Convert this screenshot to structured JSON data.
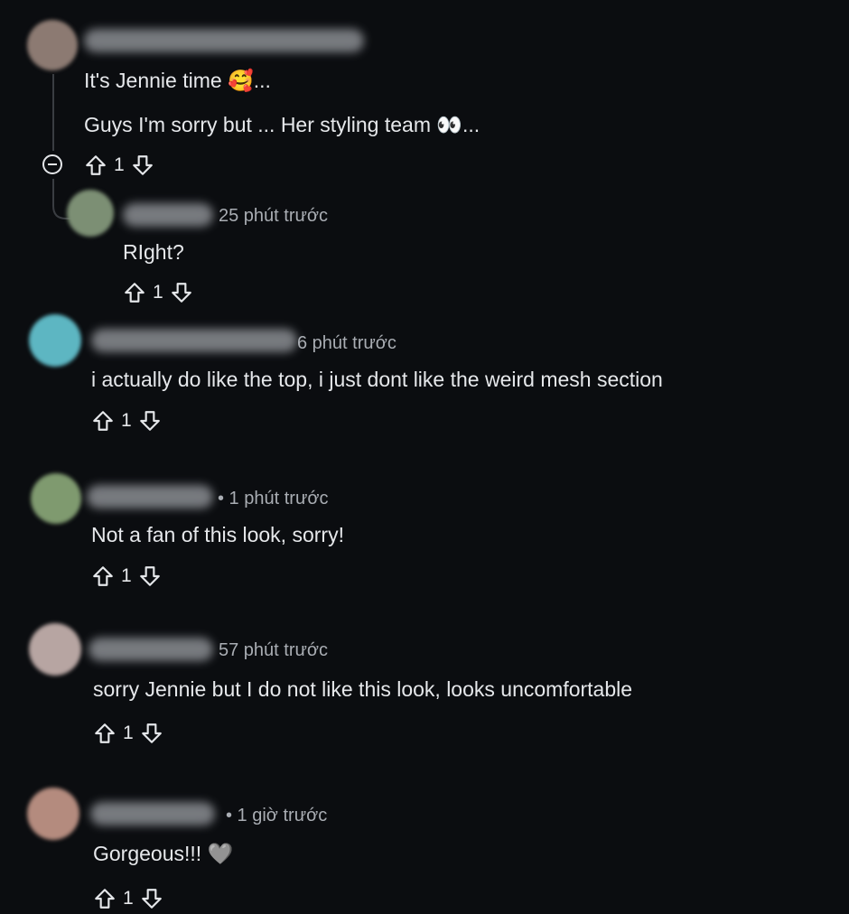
{
  "thread": {
    "parent": {
      "lines": [
        "It's Jennie time 🥰...",
        "Guys I'm sorry but ... Her styling team 👀..."
      ],
      "score": "1"
    },
    "comments": [
      {
        "time": "25 phút trước",
        "text": "RIght?",
        "score": "1",
        "avatar_color": "#7c8f74"
      },
      {
        "time": "6 phút trước",
        "text": "i actually do like the top, i just dont like the weird mesh section",
        "score": "1",
        "avatar_color": "#5db6c2"
      },
      {
        "time": "• 1 phút trước",
        "text": "Not a fan of this look, sorry!",
        "score": "1",
        "avatar_color": "#7f9a6f"
      },
      {
        "time": "57 phút trước",
        "text": "sorry Jennie but I do not like this look, looks uncomfortable",
        "score": "1",
        "avatar_color": "#b7a5a2"
      },
      {
        "time": "• 1 giờ trước",
        "text": "Gorgeous!!! 🩶",
        "score": "1",
        "avatar_color": "#b48b7e"
      }
    ],
    "parent_avatar_color": "#8c7a72"
  }
}
